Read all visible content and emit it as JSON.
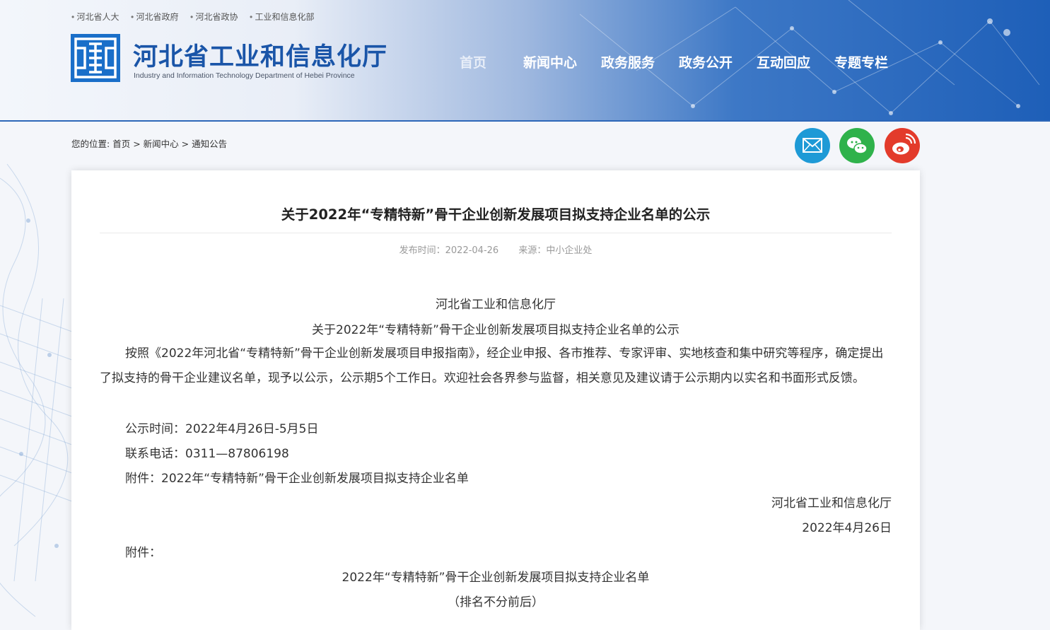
{
  "header": {
    "top_links": [
      "河北省人大",
      "河北省政府",
      "河北省政协",
      "工业和信息化部"
    ],
    "title": "河北省工业和信息化厅",
    "subtitle": "Industry and Information Technology Department of Hebei Province",
    "nav": [
      "首页",
      "新闻中心",
      "政务服务",
      "政务公开",
      "互动回应",
      "专题专栏"
    ]
  },
  "breadcrumb": {
    "prefix": "您的位置:",
    "items": [
      "首页",
      "新闻中心",
      "通知公告"
    ],
    "separator": ">"
  },
  "share": {
    "icons": [
      "mail-icon",
      "wechat-icon",
      "weibo-icon"
    ],
    "colors": [
      "#1e9ad6",
      "#2fb24b",
      "#e33b2b"
    ]
  },
  "article": {
    "title": "关于2022年“专精特新”骨干企业创新发展项目拟支持企业名单的公示",
    "meta_date": "发布时间：2022-04-26",
    "meta_source": "来源：中小企业处",
    "heading1": "河北省工业和信息化厅",
    "heading2": "关于2022年“专精特新”骨干企业创新发展项目拟支持企业名单的公示",
    "paragraph": "按照《2022年河北省“专精特新”骨干企业创新发展项目申报指南》，经企业申报、各市推荐、专家评审、实地核查和集中研究等程序，确定提出了拟支持的骨干企业建议名单，现予以公示，公示期5个工作日。欢迎社会各界参与监督，相关意见及建议请于公示期内以实名和书面形式反馈。",
    "period": "公示时间：2022年4月26日-5月5日",
    "phone": "联系电话：0311—87806198",
    "attachment_line": "附件：2022年“专精特新”骨干企业创新发展项目拟支持企业名单",
    "sign_org": "河北省工业和信息化厅",
    "sign_date": "2022年4月26日",
    "attachment_label": "附件：",
    "list_title": "2022年“专精特新”骨干企业创新发展项目拟支持企业名单",
    "list_note": "（排名不分前后）"
  }
}
